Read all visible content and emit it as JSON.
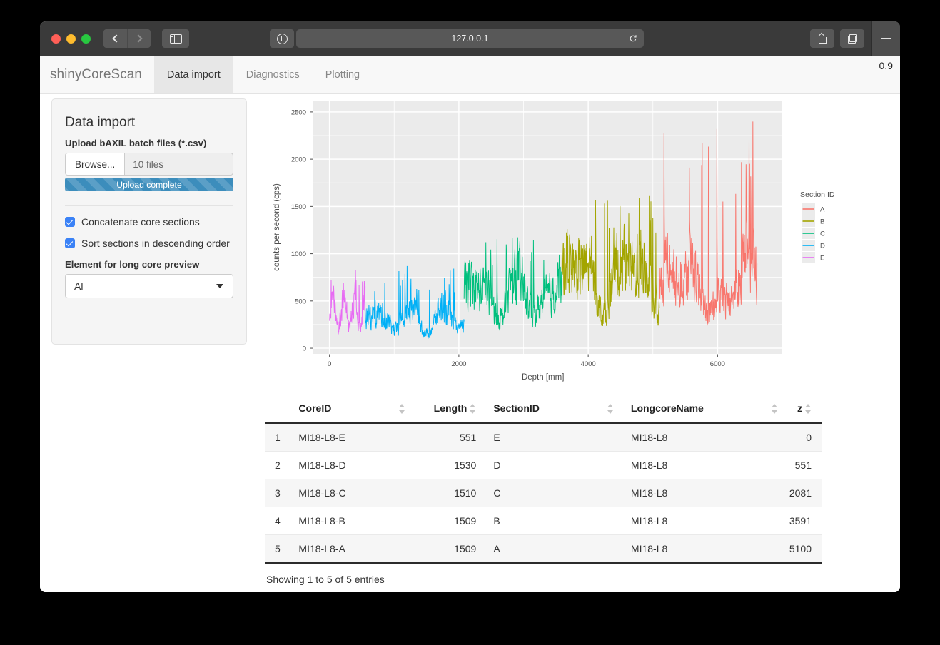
{
  "browser": {
    "url": "127.0.0.1",
    "back_icon": "chevron-left-icon",
    "forward_icon": "chevron-right-icon",
    "sidebar_icon": "sidebar-toggle-icon",
    "shield_icon": "privacy-report-icon",
    "reload_icon": "reload-icon",
    "share_icon": "share-icon",
    "tabs_icon": "show-tabs-icon",
    "new_tab_icon": "plus-icon"
  },
  "navbar": {
    "brand": "shinyCoreScan",
    "version": "0.9",
    "tabs": [
      {
        "label": "Data import",
        "active": true
      },
      {
        "label": "Diagnostics",
        "active": false
      },
      {
        "label": "Plotting",
        "active": false
      }
    ]
  },
  "sidebar": {
    "title": "Data import",
    "upload_label": "Upload bAXIL batch files (*.csv)",
    "browse_label": "Browse...",
    "file_value": "10 files",
    "progress_label": "Upload complete",
    "progress_color": "#3c8dbc",
    "checkboxes": [
      {
        "label": "Concatenate core sections",
        "checked": true
      },
      {
        "label": "Sort sections in descending order",
        "checked": true
      }
    ],
    "select_label": "Element for long core preview",
    "select_value": "Al",
    "caret_icon": "chevron-down-icon"
  },
  "chart_data": {
    "type": "line",
    "title": "",
    "xlabel": "Depth [mm]",
    "ylabel": "counts per second (cps)",
    "xlim": [
      -250,
      7000
    ],
    "ylim": [
      -60,
      2620
    ],
    "xticks": [
      0,
      2000,
      4000,
      6000
    ],
    "yticks": [
      0,
      500,
      1000,
      1500,
      2000,
      2500
    ],
    "grid": true,
    "panel_bg": "#ebebeb",
    "grid_color": "#ffffff",
    "legend_position": "right",
    "legend_title": "Section ID",
    "series": [
      {
        "name": "A",
        "color": "#f8766d",
        "x_start": 5100,
        "x_end": 6609,
        "mean": 700,
        "peak": 2480
      },
      {
        "name": "B",
        "color": "#a3a500",
        "x_start": 3591,
        "x_end": 5100,
        "mean": 780,
        "peak": 1650
      },
      {
        "name": "C",
        "color": "#00bf7d",
        "x_start": 2081,
        "x_end": 3591,
        "mean": 600,
        "peak": 1190
      },
      {
        "name": "D",
        "color": "#00b0f6",
        "x_start": 551,
        "x_end": 2081,
        "mean": 330,
        "peak": 900
      },
      {
        "name": "E",
        "color": "#e76bf3",
        "x_start": 0,
        "x_end": 551,
        "mean": 420,
        "peak": 830
      }
    ]
  },
  "table": {
    "columns": [
      {
        "key": "idx",
        "label": ""
      },
      {
        "key": "core",
        "label": "CoreID"
      },
      {
        "key": "len",
        "label": "Length"
      },
      {
        "key": "sec",
        "label": "SectionID"
      },
      {
        "key": "long",
        "label": "LongcoreName"
      },
      {
        "key": "z",
        "label": "z"
      }
    ],
    "rows": [
      {
        "idx": "1",
        "core": "MI18-L8-E",
        "len": "551",
        "sec": "E",
        "long": "MI18-L8",
        "z": "0"
      },
      {
        "idx": "2",
        "core": "MI18-L8-D",
        "len": "1530",
        "sec": "D",
        "long": "MI18-L8",
        "z": "551"
      },
      {
        "idx": "3",
        "core": "MI18-L8-C",
        "len": "1510",
        "sec": "C",
        "long": "MI18-L8",
        "z": "2081"
      },
      {
        "idx": "4",
        "core": "MI18-L8-B",
        "len": "1509",
        "sec": "B",
        "long": "MI18-L8",
        "z": "3591"
      },
      {
        "idx": "5",
        "core": "MI18-L8-A",
        "len": "1509",
        "sec": "A",
        "long": "MI18-L8",
        "z": "5100"
      }
    ],
    "footer": "Showing 1 to 5 of 5 entries"
  }
}
